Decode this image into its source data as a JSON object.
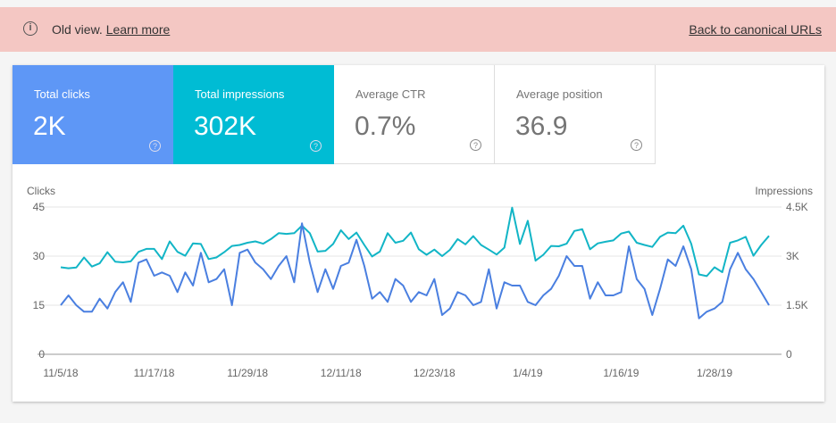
{
  "banner": {
    "icon": "info-icon",
    "message": "Old view.",
    "learn_more": "Learn more",
    "back_link": "Back to canonical URLs",
    "color": "#f4c7c3"
  },
  "metrics": [
    {
      "label": "Total clicks",
      "value": "2K",
      "color": "#5e97f6",
      "selected": true
    },
    {
      "label": "Total impressions",
      "value": "302K",
      "color": "#00bcd4",
      "selected": true
    },
    {
      "label": "Average CTR",
      "value": "0.7%",
      "selected": false
    },
    {
      "label": "Average position",
      "value": "36.9",
      "selected": false
    }
  ],
  "chart_data": {
    "type": "line",
    "left_axis_label": "Clicks",
    "right_axis_label": "Impressions",
    "left_ticks": [
      "0",
      "15",
      "30",
      "45"
    ],
    "right_ticks": [
      "0",
      "1.5K",
      "3K",
      "4.5K"
    ],
    "left_ylim": [
      0,
      45
    ],
    "right_ylim": [
      0,
      4500
    ],
    "x_range": [
      "11/5/18",
      "2/4/19"
    ],
    "x_tick_labels": [
      "11/5/18",
      "11/17/18",
      "11/29/18",
      "12/11/18",
      "12/23/18",
      "1/4/19",
      "1/16/19",
      "1/28/19"
    ],
    "grid": true,
    "series": [
      {
        "name": "Clicks",
        "axis": "left",
        "color": "#4a7fe0",
        "values": [
          15,
          18,
          15,
          13,
          13,
          17,
          14,
          19,
          22,
          16,
          28,
          29,
          24,
          25,
          24,
          19,
          25,
          21,
          31,
          22,
          23,
          26,
          15,
          31,
          32,
          28,
          26,
          23,
          27,
          30,
          22,
          40,
          28,
          19,
          26,
          20,
          27,
          28,
          35,
          27,
          17,
          19,
          16,
          23,
          21,
          16,
          19,
          18,
          23,
          12,
          14,
          19,
          18,
          15,
          16,
          26,
          14,
          22,
          21,
          21,
          16,
          15,
          18,
          20,
          24,
          30,
          27,
          27,
          17,
          22,
          18,
          18,
          19,
          33,
          23,
          20,
          12,
          20,
          29,
          27,
          33,
          26,
          11,
          13,
          14,
          16,
          26,
          31,
          26,
          23,
          19,
          15
        ]
      },
      {
        "name": "Impressions",
        "axis": "right",
        "color": "#12b5c6",
        "values": [
          2660,
          2630,
          2650,
          2960,
          2680,
          2780,
          3120,
          2830,
          2810,
          2840,
          3130,
          3220,
          3220,
          2910,
          3450,
          3130,
          3010,
          3390,
          3370,
          2910,
          2960,
          3120,
          3310,
          3340,
          3410,
          3450,
          3380,
          3520,
          3700,
          3680,
          3700,
          3930,
          3700,
          3140,
          3160,
          3370,
          3790,
          3520,
          3720,
          3340,
          2990,
          3140,
          3700,
          3410,
          3470,
          3720,
          3210,
          3040,
          3200,
          3000,
          3190,
          3520,
          3360,
          3610,
          3340,
          3200,
          3050,
          3260,
          4480,
          3370,
          4080,
          2860,
          3040,
          3310,
          3300,
          3380,
          3770,
          3820,
          3210,
          3390,
          3440,
          3480,
          3690,
          3750,
          3410,
          3340,
          3280,
          3590,
          3720,
          3700,
          3930,
          3380,
          2440,
          2390,
          2660,
          2510,
          3410,
          3480,
          3590,
          3010,
          3340,
          3620
        ]
      }
    ]
  }
}
